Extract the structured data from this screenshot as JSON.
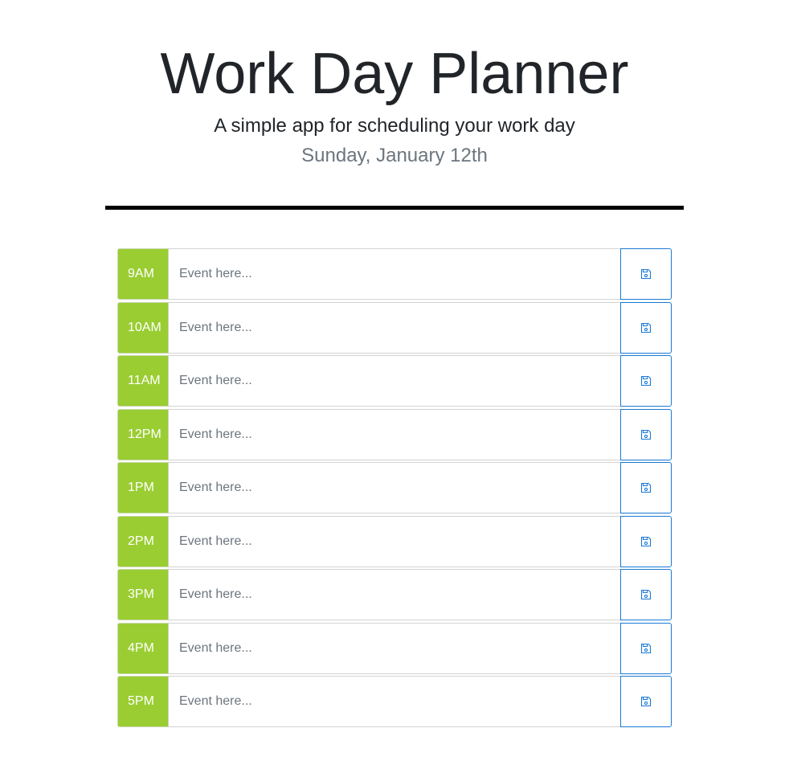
{
  "header": {
    "title": "Work Day Planner",
    "subtitle": "A simple app for scheduling your work day",
    "date": "Sunday, January 12th"
  },
  "planner": {
    "placeholder": "Event here...",
    "save_icon": "floppy-disk-icon",
    "colors": {
      "future": "#9acd32",
      "save_border": "#1a7ad4",
      "hour_text": "#ffffff",
      "date_text": "#6c757d",
      "divider": "#000000"
    },
    "hours": [
      {
        "label": "9AM",
        "value": ""
      },
      {
        "label": "10AM",
        "value": ""
      },
      {
        "label": "11AM",
        "value": ""
      },
      {
        "label": "12PM",
        "value": ""
      },
      {
        "label": "1PM",
        "value": ""
      },
      {
        "label": "2PM",
        "value": ""
      },
      {
        "label": "3PM",
        "value": ""
      },
      {
        "label": "4PM",
        "value": ""
      },
      {
        "label": "5PM",
        "value": ""
      }
    ]
  }
}
